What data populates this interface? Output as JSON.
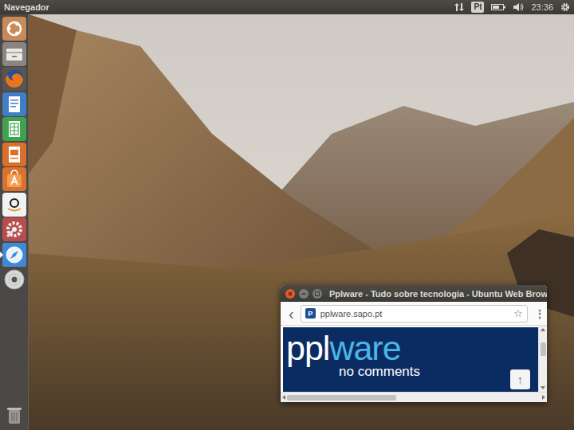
{
  "top_bar": {
    "title": "Navegador",
    "keyboard_layout": "Pt",
    "clock": "23:36"
  },
  "launcher": {
    "items": [
      {
        "kind": "dash",
        "active": false
      },
      {
        "kind": "files",
        "active": false
      },
      {
        "kind": "firefox",
        "active": false
      },
      {
        "kind": "writer",
        "active": false
      },
      {
        "kind": "calc",
        "active": false
      },
      {
        "kind": "impress",
        "active": false
      },
      {
        "kind": "software",
        "active": false
      },
      {
        "kind": "amazon",
        "active": false
      },
      {
        "kind": "settings",
        "active": false
      },
      {
        "kind": "browser",
        "active": true
      },
      {
        "kind": "disc",
        "active": false
      },
      {
        "kind": "trash",
        "active": false
      }
    ]
  },
  "browser_window": {
    "title": "Pplware - Tudo sobre tecnologia - Ubuntu Web Brow",
    "back": "‹",
    "favicon": "P",
    "url": "pplware.sapo.pt",
    "bookmark": "☆",
    "menu": "⋮",
    "logo": {
      "light": "ppl",
      "accent": "ware",
      "tagline": "no comments"
    },
    "scroll_top": "↑",
    "v_scroll": {
      "level": 0.26
    },
    "h_scroll": {
      "level": 0.43
    }
  }
}
